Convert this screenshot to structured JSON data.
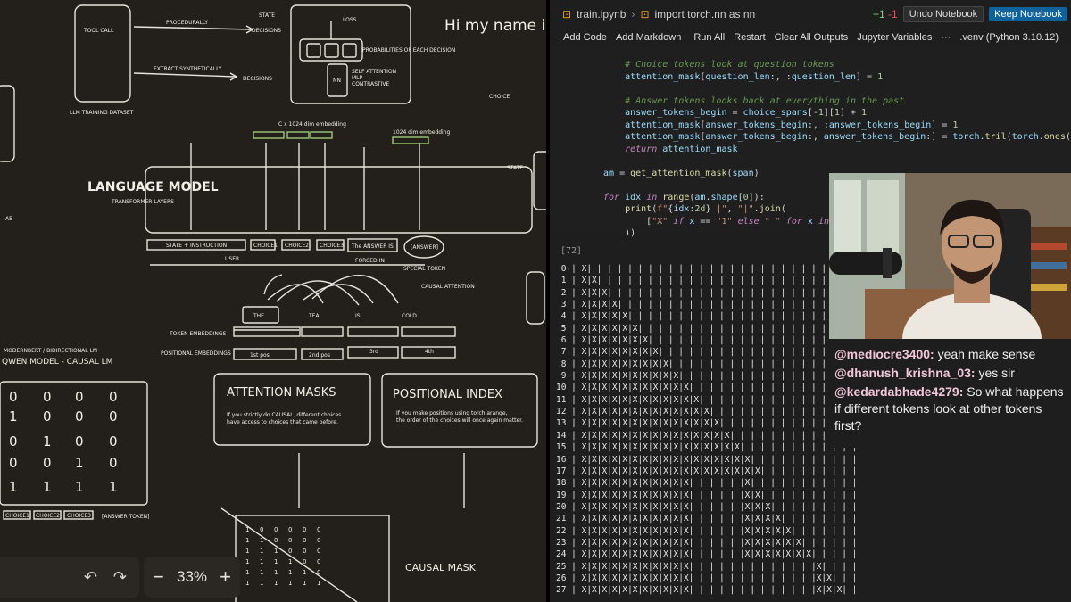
{
  "board": {
    "tool_call": "TOOL CALL",
    "procedurally": "PROCEDURALLY",
    "state": "STATE",
    "decisions": "DECISIONS",
    "extract": "EXTRACT SYNTHETICALLY",
    "decisions2": "DECISIONS",
    "llm_dataset": "LLM TRAINING DATASET",
    "loss": "LOSS",
    "prob": "PROBABILITIES OF EACH DECISION",
    "self_attn": "SELF ATTENTION",
    "mlp": "MLP",
    "contrastive": "CONTRASTIVE",
    "nn": "NN",
    "hi": "Hi my name is",
    "choice": "CHOICE",
    "state_r": "STATE",
    "emb1": "C x 1024 dim embedding",
    "emb2": "1024 dim embedding",
    "lm": "LANGUAGE MODEL",
    "tl": "TRANSFORMER LAYERS",
    "ab": "AB",
    "tok_state": "STATE + INSTRUCTION",
    "tok_c1": "CHOICE1",
    "tok_c2": "CHOICE2",
    "tok_c3": "CHOICE3",
    "tok_ans": "The ANSWER IS",
    "tok_answer": "[ANSWER]",
    "user": "USER",
    "forced": "FORCED IN",
    "special": "SPECIAL TOKEN",
    "causal_attn": "CAUSAL ATTENTION",
    "w_the": "THE",
    "w_tea": "TEA",
    "w_is": "IS",
    "w_cold": "COLD",
    "tok_emb": "TOKEN EMBEDDINGS",
    "pos_emb": "POSITIONAL EMBEDDINGS",
    "p1": "1st pos",
    "p2": "2nd pos",
    "p3": "3rd",
    "p4": "4th",
    "modernbert": "MODERNBERT / BIDIRECTIONAL LM",
    "qwen": "QWEN MODEL - CAUSAL LM",
    "am_title": "ATTENTION MASKS",
    "am_body1": "If you strictly do CAUSAL, different choices",
    "am_body2": "have access to choices that came before.",
    "pi_title": "POSITIONAL INDEX",
    "pi_body1": "If you make positions using torch.arange,",
    "pi_body2": "the order of the choices will once again matter.",
    "b_c1": "CHOICE1",
    "b_c2": "CHOICE2",
    "b_c3": "CHOICE3",
    "b_ans": "[ANSWER TOKEN]",
    "causal_mask": "CAUSAL MASK",
    "matrix": [
      [
        "0",
        "0",
        "0",
        "0"
      ],
      [
        "1",
        "0",
        "0",
        "0"
      ],
      [
        "0",
        "1",
        "0",
        "0"
      ],
      [
        "0",
        "0",
        "1",
        "0"
      ],
      [
        "1",
        "1",
        "1",
        "1"
      ]
    ],
    "zoom": "33%",
    "zoom_minus": "−",
    "zoom_plus": "+",
    "undo": "↶",
    "redo": "↷"
  },
  "notebook": {
    "file": "train.ipynb",
    "crumb": "import torch.nn as nn",
    "diff_plus": "+1",
    "diff_minus": "-1",
    "undo_nb": "Undo Notebook",
    "keep_nb": "Keep Notebook",
    "toolbar": [
      "Add Code",
      "Add Markdown",
      "Run All",
      "Restart",
      "Clear All Outputs",
      "Jupyter Variables",
      "···"
    ],
    "kernel": ".venv (Python 3.10.12)",
    "cell_no": "[72]",
    "cell_dots": "···"
  },
  "chat": [
    {
      "user": "@mediocre3400:",
      "msg": "yeah make sense"
    },
    {
      "user": "@dhanush_krishna_03:",
      "msg": "yes sir"
    },
    {
      "user": "@kedardabhade4279:",
      "msg": "So what happens if different tokens look at other tokens first?"
    }
  ],
  "output_rows": [
    " 0 | X| | | | | | | | | | | | | | | | | | | | | | | | | | |",
    " 1 | X|X| | | | | | | | | | | | | | | | | | | | | | | | | |",
    " 2 | X|X|X| | | | | | | | | | | | | | | | | | | | | | | | |",
    " 3 | X|X|X|X| | | | | | | | | | | | | | | | | | | | | | | |",
    " 4 | X|X|X|X|X| | | | | | | | | | | | | | | | | | | | | | |",
    " 5 | X|X|X|X|X|X| | | | | | | | | | | | | | | | | | | | | |",
    " 6 | X|X|X|X|X|X|X| | | | | | | | | | | | | | | | | | | | |",
    " 7 | X|X|X|X|X|X|X|X| | | | | | | | | | | | | | | | | | | |",
    " 8 | X|X|X|X|X|X|X|X|X| | | | | | | | | | | | | | | | | | |",
    " 9 | X|X|X|X|X|X|X|X|X|X| | | | | | | | | | | | | | | | | |",
    "10 | X|X|X|X|X|X|X|X|X|X|X| | | | | | | | | | | | | | | | |",
    "11 | X|X|X|X|X|X|X|X|X|X|X|X| | | | | | | | | | | | | | | |",
    "12 | X|X|X|X|X|X|X|X|X|X|X|X|X| | | | | | | | | | | | | | |",
    "13 | X|X|X|X|X|X|X|X|X|X|X|X|X|X| | | | | | | | | | | | | |",
    "14 | X|X|X|X|X|X|X|X|X|X|X|X|X|X|X| | | | | | | | | | | | |",
    "15 | X|X|X|X|X|X|X|X|X|X|X|X|X|X|X|X| | | | | | | | | | | |",
    "16 | X|X|X|X|X|X|X|X|X|X|X|X|X|X|X|X|X| | | | | | | | | | |",
    "17 | X|X|X|X|X|X|X|X|X|X|X|X|X|X|X|X|X|X| | | | | | | | | |",
    "18 | X|X|X|X|X|X|X|X|X|X|X| | | | | |X| | | | | | | | | | |",
    "19 | X|X|X|X|X|X|X|X|X|X|X| | | | | |X|X| | | | | | | | | |",
    "20 | X|X|X|X|X|X|X|X|X|X|X| | | | | |X|X|X| | | | | | | | |",
    "21 | X|X|X|X|X|X|X|X|X|X|X| | | | | |X|X|X|X| | | | | | | |",
    "22 | X|X|X|X|X|X|X|X|X|X|X| | | | | |X|X|X|X|X| | | | | | |",
    "23 | X|X|X|X|X|X|X|X|X|X|X| | | | | |X|X|X|X|X|X| | | | | |",
    "24 | X|X|X|X|X|X|X|X|X|X|X| | | | | |X|X|X|X|X|X|X| | | | |",
    "25 | X|X|X|X|X|X|X|X|X|X|X| | | | | | | | | | | | |X| | | |",
    "26 | X|X|X|X|X|X|X|X|X|X|X| | | | | | | | | | | | |X|X| | |",
    "27 | X|X|X|X|X|X|X|X|X|X|X| | | | | | | | | | | | |X|X|X| |"
  ]
}
